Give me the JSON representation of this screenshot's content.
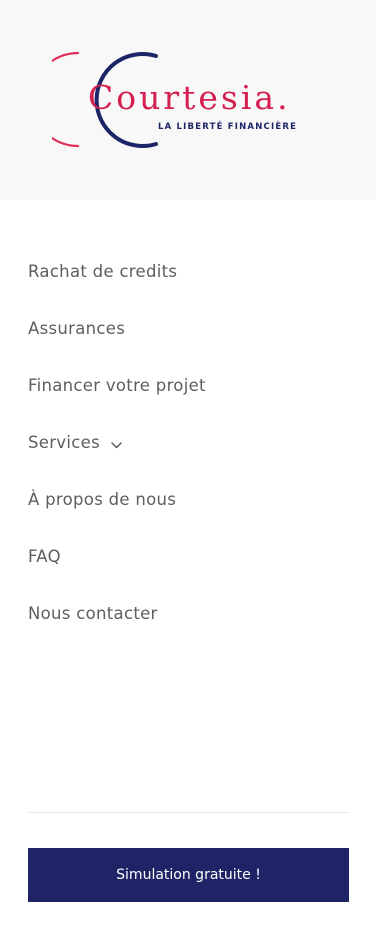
{
  "brand": {
    "name": "Courtesia.",
    "tagline": "LA LIBERTÉ FINANCIÈRE",
    "primary_color": "#d4204f",
    "secondary_color": "#1c2566"
  },
  "nav": {
    "items": [
      {
        "label": "Rachat de credits"
      },
      {
        "label": "Assurances"
      },
      {
        "label": "Financer votre projet"
      },
      {
        "label": "Services",
        "icon": "chevron-down-icon"
      },
      {
        "label": "À propos de nous"
      },
      {
        "label": "FAQ"
      },
      {
        "label": "Nous contacter"
      }
    ]
  },
  "cta": {
    "label": "Simulation gratuite !",
    "background": "#1f2466"
  }
}
